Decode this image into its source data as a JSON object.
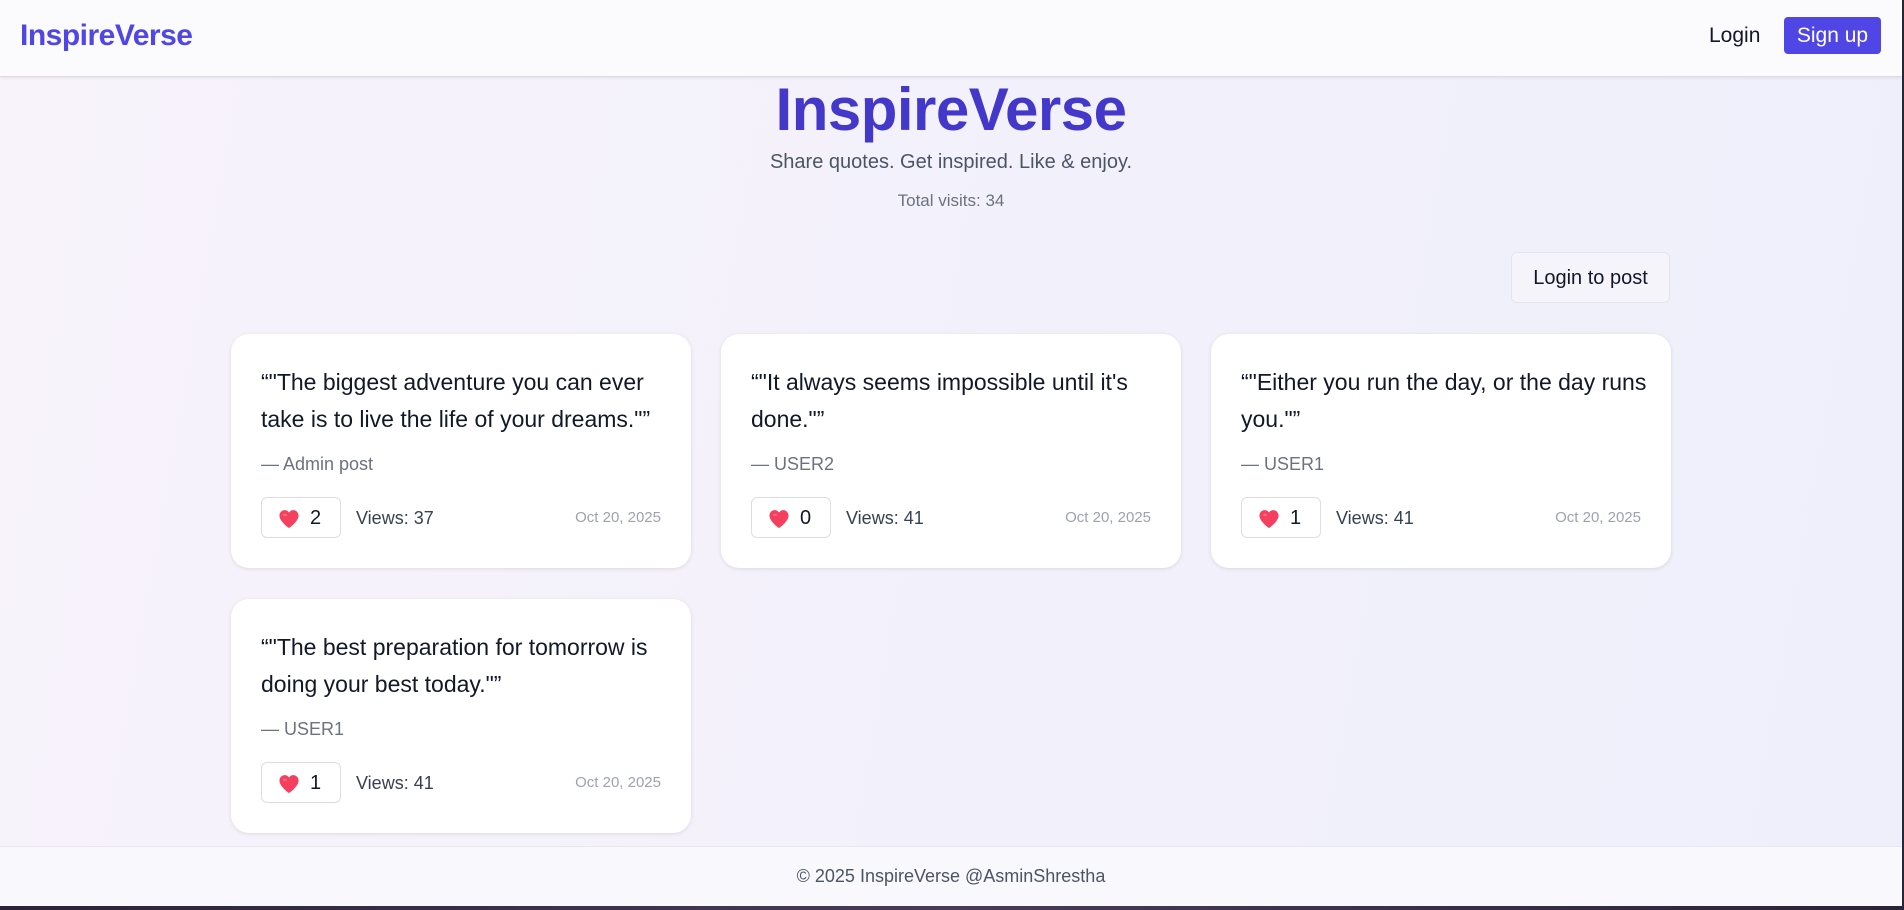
{
  "navbar": {
    "brand": "InspireVerse",
    "login_label": "Login",
    "signup_label": "Sign up"
  },
  "hero": {
    "title": "InspireVerse",
    "subtitle": "Share quotes. Get inspired. Like & enjoy.",
    "visits": "Total visits: 34"
  },
  "actions": {
    "login_to_post_label": "Login to post"
  },
  "quotes": [
    {
      "text": "“\"The biggest adventure you can ever take is to live the life of your dreams.\"”",
      "author": "— Admin post",
      "likes": "2",
      "views": "Views: 37",
      "date": "Oct 20, 2025"
    },
    {
      "text": "“\"It always seems impossible until it's done.\"”",
      "author": "— USER2",
      "likes": "0",
      "views": "Views: 41",
      "date": "Oct 20, 2025"
    },
    {
      "text": "“\"Either you run the day, or the day runs you.\"”",
      "author": "— USER1",
      "likes": "1",
      "views": "Views: 41",
      "date": "Oct 20, 2025"
    },
    {
      "text": "“\"The best preparation for tomorrow is doing your best today.\"”",
      "author": "— USER1",
      "likes": "1",
      "views": "Views: 41",
      "date": "Oct 20, 2025"
    }
  ],
  "footer": {
    "text": "© 2025 InspireVerse @AsminShrestha"
  },
  "icons": {
    "like": "heart-icon"
  },
  "colors": {
    "accent": "#4f46e5",
    "title": "#4338ca",
    "heart": "#f43f5e"
  }
}
